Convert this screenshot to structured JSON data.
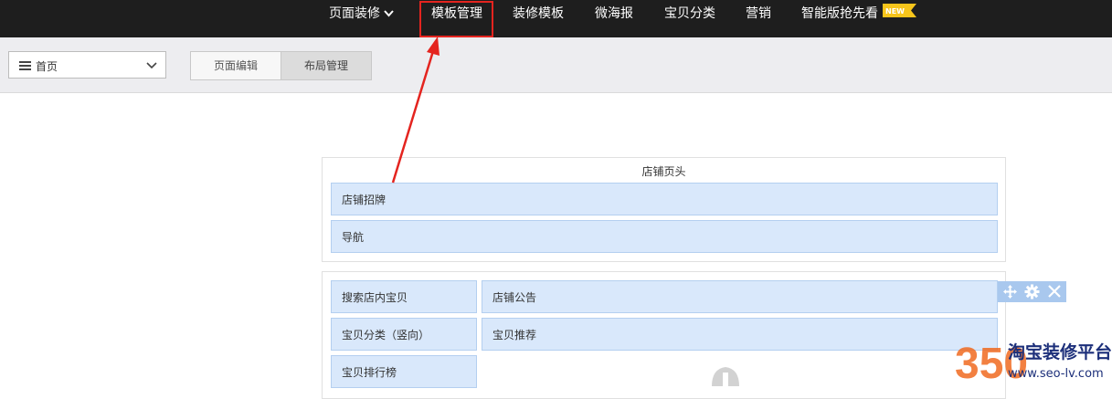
{
  "topnav": {
    "items": [
      {
        "label": "页面装修"
      },
      {
        "label": "模板管理"
      },
      {
        "label": "装修模板"
      },
      {
        "label": "微海报"
      },
      {
        "label": "宝贝分类"
      },
      {
        "label": "营销"
      },
      {
        "label": "智能版抢先看"
      }
    ],
    "badge": "NEW"
  },
  "toolbar": {
    "page_select": {
      "value": "首页"
    },
    "tabs": [
      {
        "label": "页面编辑"
      },
      {
        "label": "布局管理"
      }
    ]
  },
  "header_section": {
    "title": "店铺页头",
    "modules": [
      "店铺招牌",
      "导航"
    ]
  },
  "body_section": {
    "left_modules": [
      "搜索店内宝贝",
      "宝贝分类（竖向）",
      "宝贝排行榜"
    ],
    "right_modules": [
      "店铺公告",
      "宝贝推荐"
    ]
  },
  "watermark": {
    "number": "350",
    "name": "淘宝装修平台",
    "url": "www.seo-lv.com"
  },
  "colors": {
    "nav_bg": "#1e1e1e",
    "module_bg": "#d9e8fb",
    "module_border": "#b4cff0",
    "highlight": "#e4241f",
    "badge": "#f7c51b"
  }
}
